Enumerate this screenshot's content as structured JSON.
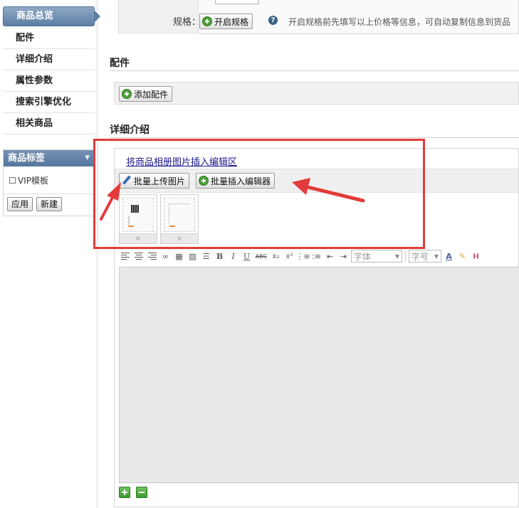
{
  "sidebar": {
    "active_item": "商品总览",
    "items": [
      "配件",
      "详细介绍",
      "属性参数",
      "搜索引擎优化",
      "相关商品"
    ],
    "tags_panel": {
      "title": "商品标签",
      "checkbox_label": "VIP模板",
      "apply_label": "应用",
      "new_label": "新建"
    }
  },
  "spec": {
    "label": "规格：",
    "enable_button": "开启规格",
    "help_mark": "?",
    "hint": "开启规格前先填写以上价格等信息，可自动复制信息到货品"
  },
  "accessories": {
    "title": "配件",
    "add_button": "添加配件"
  },
  "details": {
    "title": "详细介绍",
    "album_link": "将商品相册图片插入编辑区",
    "batch_upload_button": "批量上传图片",
    "batch_insert_button": "批量插入编辑器",
    "thumbnails": [
      {
        "remove_label": "×"
      },
      {
        "remove_label": "×"
      }
    ],
    "toolbar": {
      "font_placeholder": "字体",
      "size_placeholder": "字号"
    }
  },
  "colors": {
    "annotation": "#e33b3b",
    "active_nav": "#5c7ea3",
    "accent_green": "#4ea03a"
  },
  "icons": [
    "plus-circle-icon",
    "help-icon",
    "pencil-icon",
    "align-left-icon",
    "align-center-icon",
    "align-right-icon",
    "link-icon",
    "table-icon",
    "image-icon",
    "horizontal-rule-icon",
    "bold-icon",
    "italic-icon",
    "underline-icon",
    "strikethrough-icon",
    "subscript-icon",
    "superscript-icon",
    "ordered-list-icon",
    "unordered-list-icon",
    "outdent-icon",
    "indent-icon",
    "font-color-icon",
    "highlight-icon",
    "expand-icon",
    "collapse-icon"
  ]
}
